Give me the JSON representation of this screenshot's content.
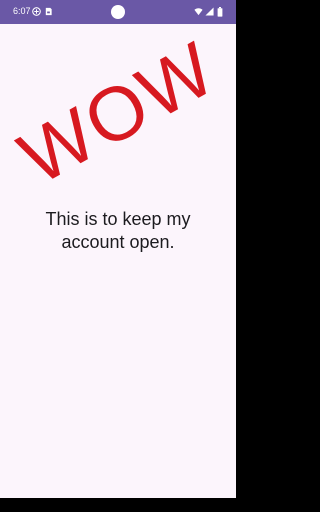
{
  "status_bar": {
    "time": "6:07",
    "icons": [
      "vpn-icon",
      "sim-card-icon",
      "camera-cutout",
      "wifi-icon",
      "cellular-signal-icon",
      "battery-icon"
    ],
    "background_color": "#6a58a6"
  },
  "main": {
    "wow_text": "WOW",
    "message": "This is to keep my account open.",
    "wow_color": "#d71920",
    "background_color": "#fcf5fc"
  },
  "navigation_bar": {
    "background_color": "#000000"
  }
}
